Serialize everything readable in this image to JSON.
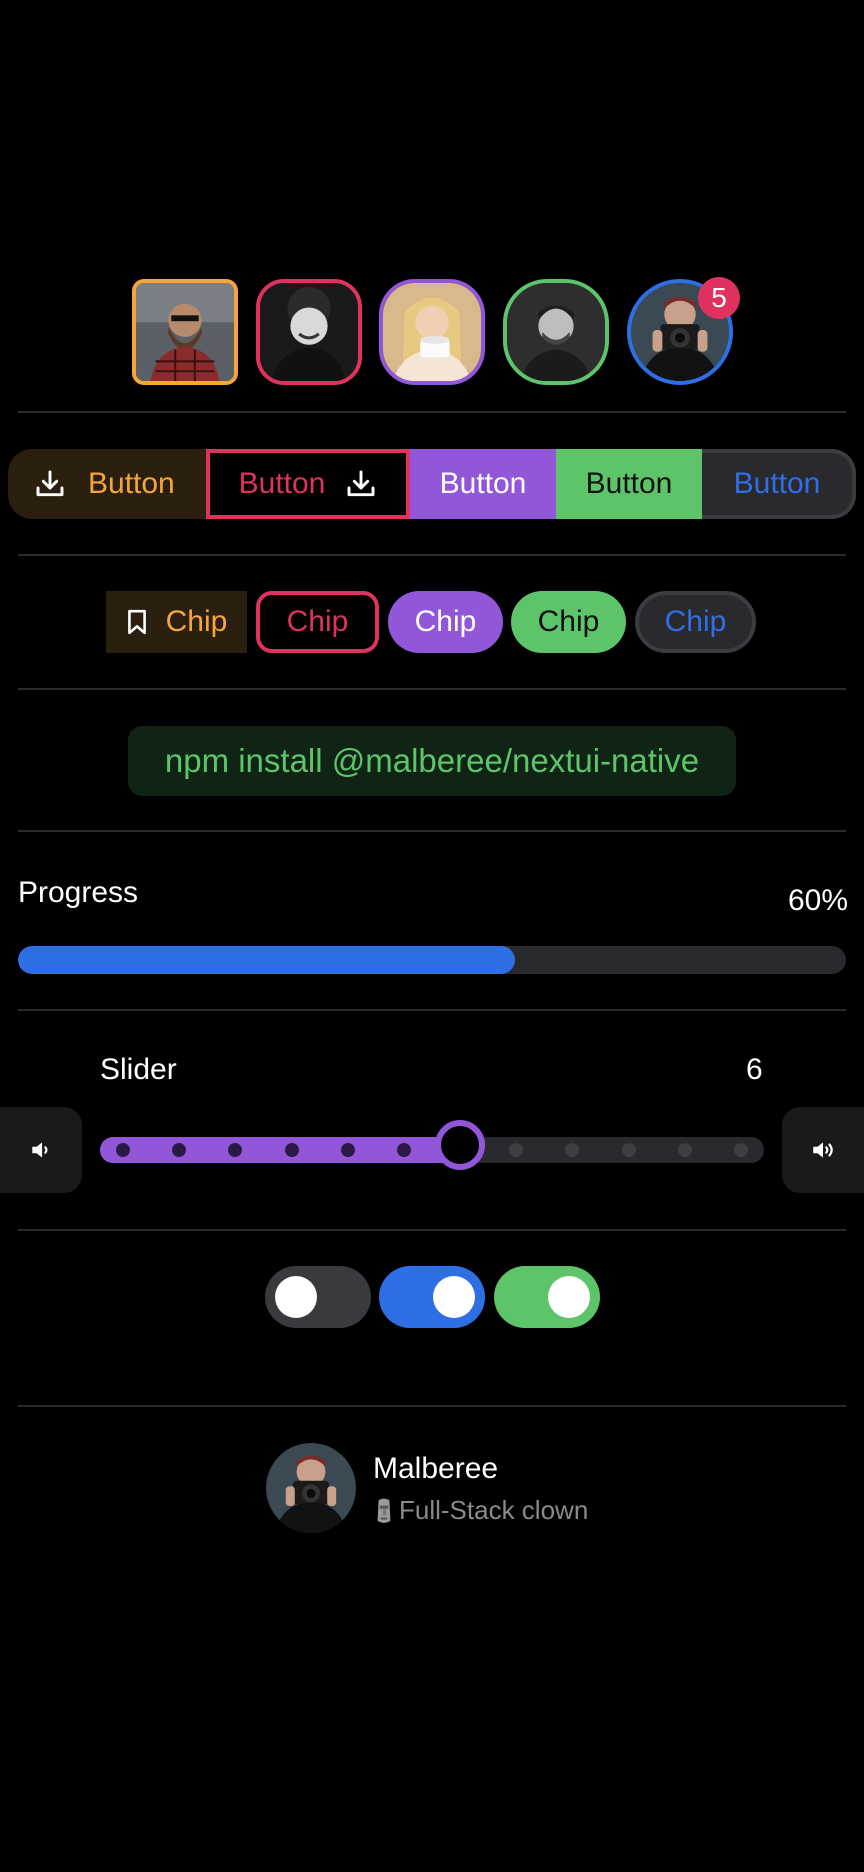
{
  "avatars": [
    {
      "name": "avatar-bearded-man",
      "border": "#f5a63a"
    },
    {
      "name": "avatar-curly-man",
      "border": "#e0325f"
    },
    {
      "name": "avatar-woman-coffee",
      "border": "#9257d9"
    },
    {
      "name": "avatar-man-portrait",
      "border": "#5ec46a"
    },
    {
      "name": "avatar-photographer",
      "border": "#2f6fe6"
    }
  ],
  "badge": {
    "count": "5"
  },
  "button_group": {
    "labels": [
      "Button",
      "Button",
      "Button",
      "Button",
      "Button"
    ],
    "icons": [
      "download-icon",
      "download-icon"
    ]
  },
  "chips": {
    "labels": [
      "Chip",
      "Chip",
      "Chip",
      "Chip",
      "Chip"
    ],
    "icon": "bookmark-icon"
  },
  "code": {
    "text": "npm install @malberee/nextui-native"
  },
  "progress": {
    "label": "Progress",
    "value_text": "60%",
    "value": 0.6
  },
  "slider": {
    "label": "Slider",
    "value_text": "6",
    "value": 6,
    "min": 0,
    "max": 11,
    "icons": [
      "volume-low-icon",
      "volume-high-icon"
    ]
  },
  "switches": [
    {
      "state": "off",
      "color": "#3a3a3e"
    },
    {
      "state": "on",
      "color": "#2f6fe6"
    },
    {
      "state": "on",
      "color": "#5ec46a"
    }
  ],
  "user": {
    "name": "Malberee",
    "description": "Full-Stack clown",
    "emoji_icon": "moai-icon"
  },
  "colors": {
    "warning": "#f5a63a",
    "danger": "#e0325f",
    "secondary": "#9257d9",
    "success": "#5ec46a",
    "primary": "#2f6fe6"
  }
}
